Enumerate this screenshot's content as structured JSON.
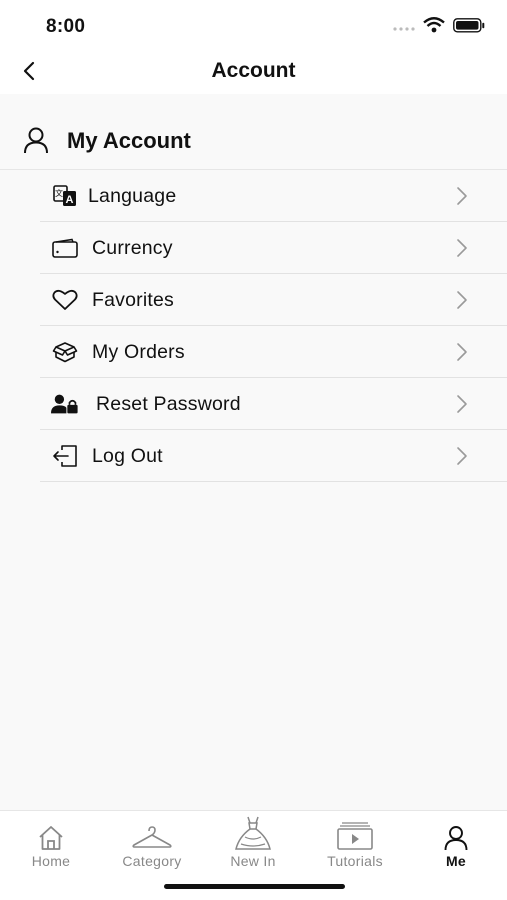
{
  "status": {
    "time": "8:00"
  },
  "nav": {
    "title": "Account",
    "back_icon": "chevron-left-icon"
  },
  "section": {
    "title": "My Account",
    "icon": "person-icon"
  },
  "menu": [
    {
      "label": "Language",
      "icon": "translate-icon"
    },
    {
      "label": "Currency",
      "icon": "wallet-icon"
    },
    {
      "label": "Favorites",
      "icon": "heart-icon"
    },
    {
      "label": "My Orders",
      "icon": "box-icon"
    },
    {
      "label": "Reset Password",
      "icon": "user-lock-icon"
    },
    {
      "label": "Log Out",
      "icon": "logout-icon"
    }
  ],
  "tabs": [
    {
      "label": "Home",
      "icon": "home-icon",
      "active": false
    },
    {
      "label": "Category",
      "icon": "hanger-icon",
      "active": false
    },
    {
      "label": "New In",
      "icon": "dress-icon",
      "active": false
    },
    {
      "label": "Tutorials",
      "icon": "video-icon",
      "active": false
    },
    {
      "label": "Me",
      "icon": "person-icon",
      "active": true
    }
  ],
  "colors": {
    "active_tab": "#111111",
    "inactive_tab": "#888888",
    "background": "#f9f9f9"
  }
}
